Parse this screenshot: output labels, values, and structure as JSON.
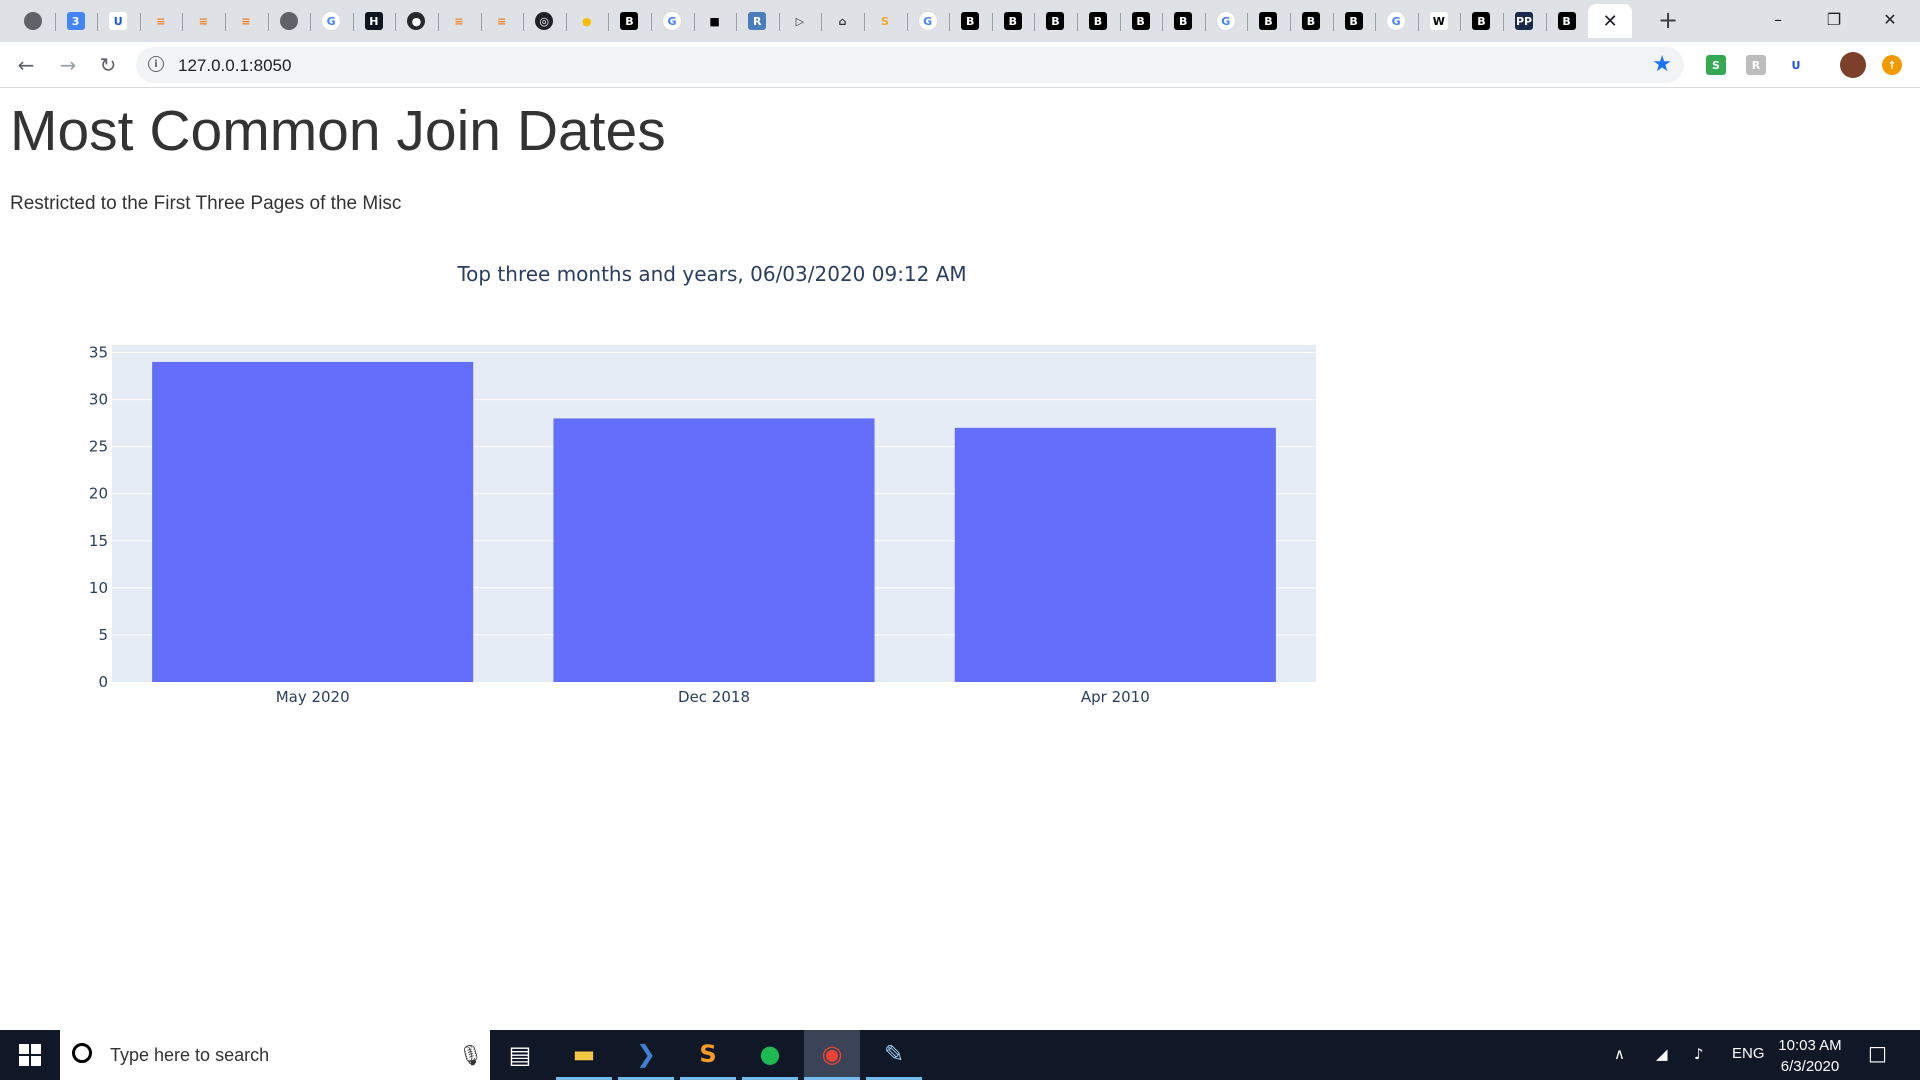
{
  "browser": {
    "tabs": [
      {
        "icon": "globe-icon",
        "glyph": "",
        "bg": "#5f6368",
        "fg": "#ffffff",
        "shape": "circle"
      },
      {
        "icon": "calendar-icon",
        "glyph": "3",
        "bg": "#4285f4",
        "fg": "#ffffff",
        "shape": "square"
      },
      {
        "icon": "shield-u-icon",
        "glyph": "U",
        "bg": "#ffffff",
        "fg": "#1a56db",
        "shape": "square"
      },
      {
        "icon": "stackoverflow-icon",
        "glyph": "≡",
        "bg": "#dee1e6",
        "fg": "#f48024",
        "shape": "square"
      },
      {
        "icon": "stackoverflow-icon",
        "glyph": "≡",
        "bg": "#dee1e6",
        "fg": "#f48024",
        "shape": "square"
      },
      {
        "icon": "stackoverflow-icon",
        "glyph": "≡",
        "bg": "#dee1e6",
        "fg": "#f48024",
        "shape": "square"
      },
      {
        "icon": "globe-icon",
        "glyph": "",
        "bg": "#5f6368",
        "fg": "#ffffff",
        "shape": "circle"
      },
      {
        "icon": "google-icon",
        "glyph": "G",
        "bg": "#ffffff",
        "fg": "#4285f4",
        "shape": "circle"
      },
      {
        "icon": "hackerrank-icon",
        "glyph": "H",
        "bg": "#0e141e",
        "fg": "#ffffff",
        "shape": "square"
      },
      {
        "icon": "github-icon",
        "glyph": "●",
        "bg": "#24292e",
        "fg": "#ffffff",
        "shape": "circle"
      },
      {
        "icon": "stackoverflow-icon",
        "glyph": "≡",
        "bg": "#dee1e6",
        "fg": "#f48024",
        "shape": "square"
      },
      {
        "icon": "stackoverflow-icon",
        "glyph": "≡",
        "bg": "#dee1e6",
        "fg": "#f48024",
        "shape": "square"
      },
      {
        "icon": "chromium-icon",
        "glyph": "◎",
        "bg": "#202124",
        "fg": "#ffffff",
        "shape": "circle"
      },
      {
        "icon": "map-pin-icon",
        "glyph": "●",
        "bg": "#dee1e6",
        "fg": "#fbbc04",
        "shape": "square"
      },
      {
        "icon": "b-logo-icon",
        "glyph": "B",
        "bg": "#000000",
        "fg": "#ffffff",
        "shape": "square"
      },
      {
        "icon": "google-icon",
        "glyph": "G",
        "bg": "#ffffff",
        "fg": "#4285f4",
        "shape": "circle"
      },
      {
        "icon": "document-icon",
        "glyph": "■",
        "bg": "#dee1e6",
        "fg": "#000000",
        "shape": "square"
      },
      {
        "icon": "r-logo-icon",
        "glyph": "R",
        "bg": "#4a7ebb",
        "fg": "#ffffff",
        "shape": "square"
      },
      {
        "icon": "video-icon",
        "glyph": "▷",
        "bg": "#dee1e6",
        "fg": "#333333",
        "shape": "square"
      },
      {
        "icon": "library-icon",
        "glyph": "⌂",
        "bg": "#dee1e6",
        "fg": "#333333",
        "shape": "square"
      },
      {
        "icon": "sublime-icon",
        "glyph": "S",
        "bg": "#dee1e6",
        "fg": "#f5a623",
        "shape": "square"
      },
      {
        "icon": "google-icon",
        "glyph": "G",
        "bg": "#ffffff",
        "fg": "#4285f4",
        "shape": "circle"
      },
      {
        "icon": "b-logo-icon",
        "glyph": "B",
        "bg": "#000000",
        "fg": "#ffffff",
        "shape": "square"
      },
      {
        "icon": "b-logo-icon",
        "glyph": "B",
        "bg": "#000000",
        "fg": "#ffffff",
        "shape": "square"
      },
      {
        "icon": "b-logo-icon",
        "glyph": "B",
        "bg": "#000000",
        "fg": "#ffffff",
        "shape": "square"
      },
      {
        "icon": "b-logo-icon",
        "glyph": "B",
        "bg": "#000000",
        "fg": "#ffffff",
        "shape": "square"
      },
      {
        "icon": "b-logo-icon",
        "glyph": "B",
        "bg": "#000000",
        "fg": "#ffffff",
        "shape": "square"
      },
      {
        "icon": "b-logo-icon",
        "glyph": "B",
        "bg": "#000000",
        "fg": "#ffffff",
        "shape": "square"
      },
      {
        "icon": "google-icon",
        "glyph": "G",
        "bg": "#ffffff",
        "fg": "#4285f4",
        "shape": "circle"
      },
      {
        "icon": "b-logo-icon",
        "glyph": "B",
        "bg": "#000000",
        "fg": "#ffffff",
        "shape": "square"
      },
      {
        "icon": "b-logo-icon",
        "glyph": "B",
        "bg": "#000000",
        "fg": "#ffffff",
        "shape": "square"
      },
      {
        "icon": "b-logo-icon",
        "glyph": "B",
        "bg": "#000000",
        "fg": "#ffffff",
        "shape": "square"
      },
      {
        "icon": "google-icon",
        "glyph": "G",
        "bg": "#ffffff",
        "fg": "#4285f4",
        "shape": "circle"
      },
      {
        "icon": "wikipedia-icon",
        "glyph": "W",
        "bg": "#ffffff",
        "fg": "#000000",
        "shape": "square"
      },
      {
        "icon": "b-logo-icon",
        "glyph": "B",
        "bg": "#000000",
        "fg": "#ffffff",
        "shape": "square"
      },
      {
        "icon": "pp-logo-icon",
        "glyph": "PP",
        "bg": "#1b2a4a",
        "fg": "#ffffff",
        "shape": "square"
      },
      {
        "icon": "b-logo-icon",
        "glyph": "B",
        "bg": "#000000",
        "fg": "#ffffff",
        "shape": "square"
      }
    ],
    "active_tab_close": "✕",
    "new_tab": "+",
    "window_controls": {
      "minimize": "–",
      "maximize": "❐",
      "close": "✕"
    },
    "nav": {
      "back": "←",
      "forward": "→",
      "reload": "↻"
    },
    "url": "127.0.0.1:8050",
    "bookmark_star": "★",
    "extensions": [
      {
        "icon": "sheets-extension-icon",
        "glyph": "S",
        "bg": "#34a853",
        "fg": "#ffffff"
      },
      {
        "icon": "grey-extension-icon",
        "glyph": "R",
        "bg": "#bdbdbd",
        "fg": "#ffffff"
      },
      {
        "icon": "shield-u-extension-icon",
        "glyph": "U",
        "bg": "#ffffff",
        "fg": "#1a56db"
      },
      {
        "icon": "profile-avatar-icon",
        "glyph": "",
        "bg": "#7b3f2a",
        "fg": "#ffffff"
      },
      {
        "icon": "update-badge-icon",
        "glyph": "↑",
        "bg": "#f29900",
        "fg": "#ffffff"
      }
    ]
  },
  "page": {
    "title": "Most Common Join Dates",
    "subtitle": "Restricted to the First Three Pages of the Misc"
  },
  "chart_data": {
    "type": "bar",
    "title": "Top three months and years, 06/03/2020 09:12 AM",
    "categories": [
      "May 2020",
      "Dec 2018",
      "Apr 2010"
    ],
    "values": [
      34,
      28,
      27
    ],
    "ylim": [
      0,
      35.8
    ],
    "yticks": [
      0,
      5,
      10,
      15,
      20,
      25,
      30,
      35
    ],
    "xlabel": "",
    "ylabel": "",
    "grid": true,
    "bar_color": "#636efa",
    "plot_bg": "#e5ecf6"
  },
  "taskbar": {
    "search_placeholder": "Type here to search",
    "apps": [
      {
        "icon": "task-view-icon",
        "glyph": "▤",
        "color": "#ffffff",
        "state": ""
      },
      {
        "icon": "file-explorer-icon",
        "glyph": "▬",
        "color": "#f4c542",
        "state": "running"
      },
      {
        "icon": "powershell-icon",
        "glyph": "❯",
        "color": "#3f7fd6",
        "state": "running"
      },
      {
        "icon": "sublime-text-icon",
        "glyph": "S",
        "color": "#f59b23",
        "state": "running"
      },
      {
        "icon": "spotify-icon",
        "glyph": "●",
        "color": "#1db954",
        "state": "running"
      },
      {
        "icon": "chrome-icon",
        "glyph": "◉",
        "color": "#ea4335",
        "state": "running active"
      },
      {
        "icon": "paint-icon",
        "glyph": "✎",
        "color": "#9ecbf0",
        "state": "running"
      }
    ],
    "tray": {
      "chevron": "∧",
      "network": "◢",
      "volume": "♪",
      "language": "ENG",
      "notifications": "□"
    },
    "time": "10:03 AM",
    "date": "6/3/2020"
  }
}
